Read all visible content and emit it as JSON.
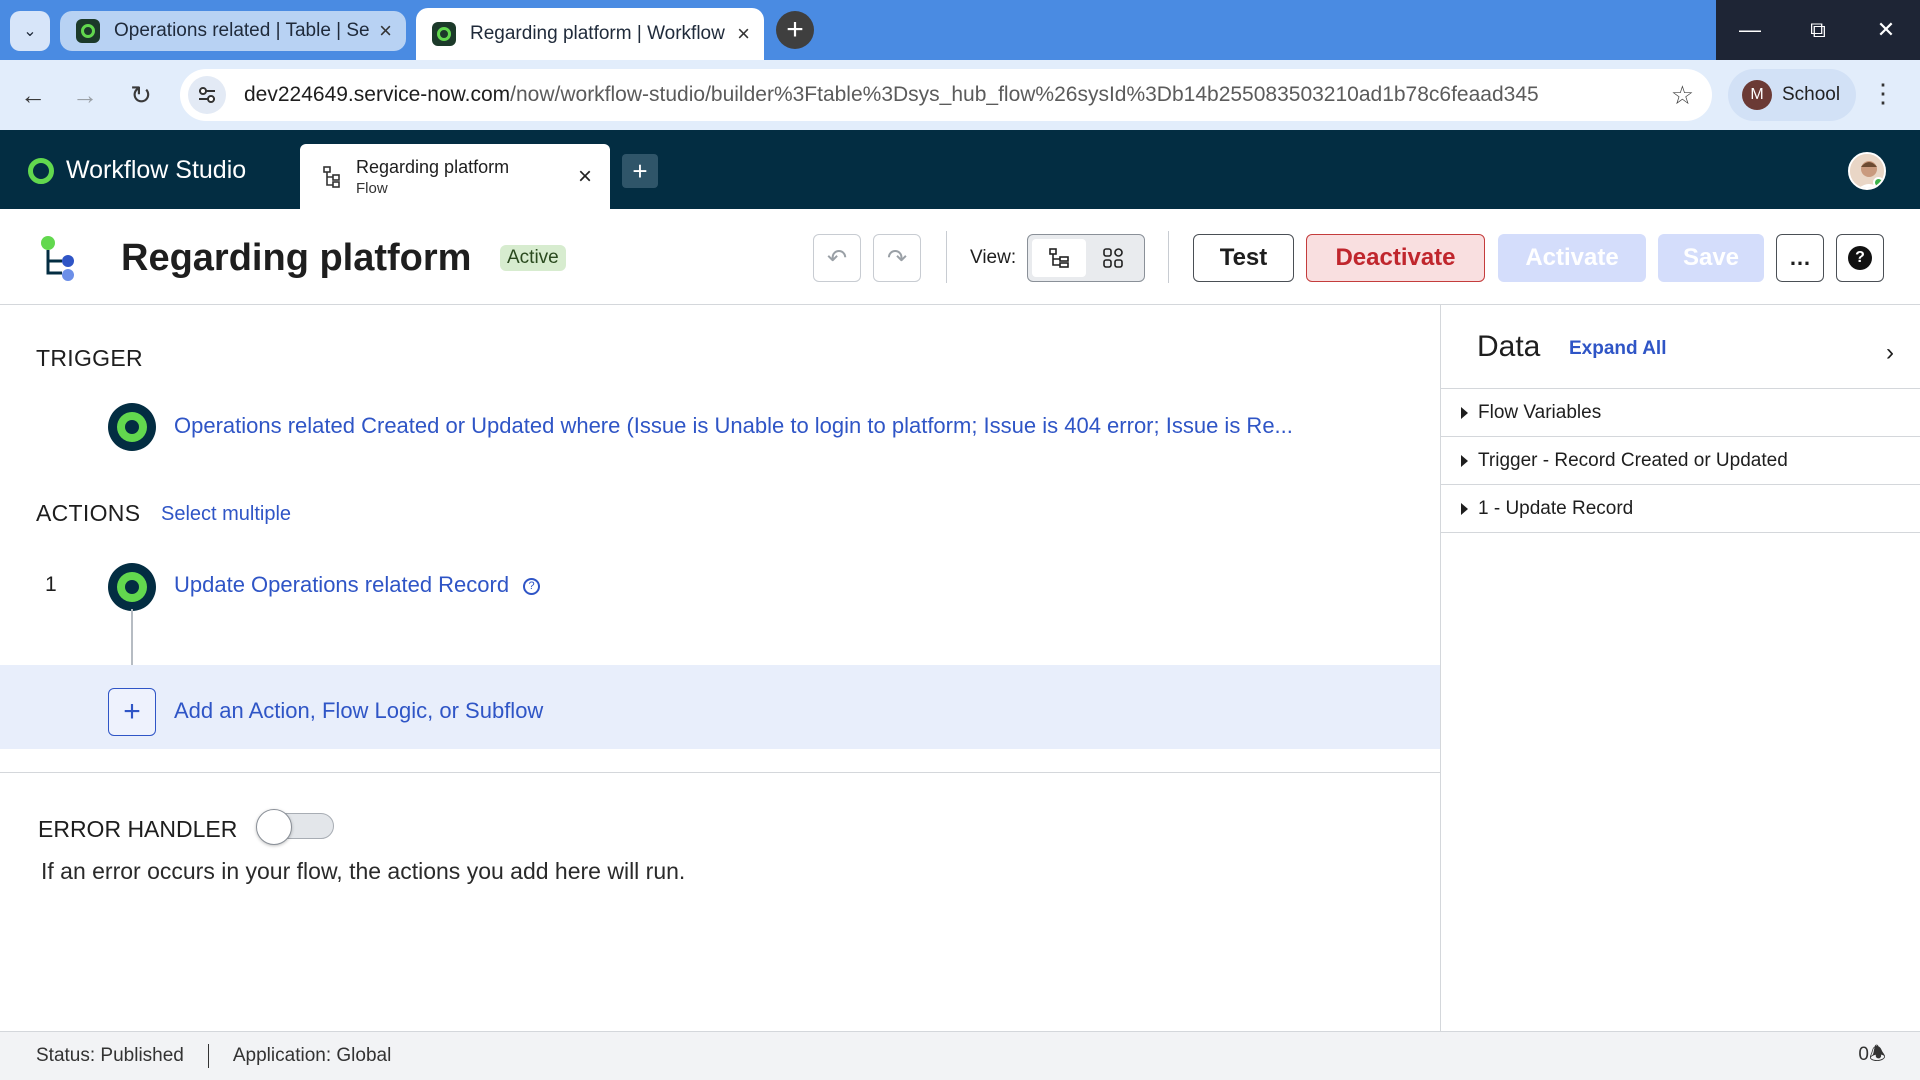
{
  "browser": {
    "tabs": [
      {
        "title": "Operations related | Table | Serv",
        "active": false
      },
      {
        "title": "Regarding platform | Workflow",
        "active": true
      }
    ],
    "url_host": "dev224649.service-now.com",
    "url_path": "/now/workflow-studio/builder%3Ftable%3Dsys_hub_flow%26sysId%3Db14b255083503210ad1b78c6feaad345",
    "profile_initial": "M",
    "profile_label": "School"
  },
  "app": {
    "brand": "Workflow Studio",
    "tab": {
      "title": "Regarding platform",
      "subtitle": "Flow"
    }
  },
  "flow": {
    "title": "Regarding platform",
    "status_badge": "Active",
    "view_label": "View:",
    "buttons": {
      "test": "Test",
      "deactivate": "Deactivate",
      "activate": "Activate",
      "save": "Save",
      "more": "…",
      "help": "?"
    }
  },
  "canvas": {
    "trigger_heading": "TRIGGER",
    "trigger_text": "Operations related Created or Updated where (Issue is Unable to login to platform; Issue is 404 error; Issue is Re...",
    "actions_heading": "ACTIONS",
    "select_multiple": "Select multiple",
    "actions": [
      {
        "number": "1",
        "label": "Update Operations related Record"
      }
    ],
    "add_label": "Add an Action, Flow Logic, or Subflow",
    "error_heading": "ERROR HANDLER",
    "error_toggle_on": false,
    "error_description": "If an error occurs in your flow, the actions you add here will run."
  },
  "data_panel": {
    "title": "Data",
    "expand_all": "Expand All",
    "items": [
      "Flow Variables",
      "Trigger - Record Created or Updated",
      "1 - Update Record"
    ]
  },
  "statusbar": {
    "status": "Status: Published",
    "application": "Application: Global",
    "notifications": "0"
  },
  "colors": {
    "header_bg": "#032d42",
    "accent_green": "#62d84e",
    "link_blue": "#2f55c6",
    "deactivate_red": "#c0262d"
  }
}
